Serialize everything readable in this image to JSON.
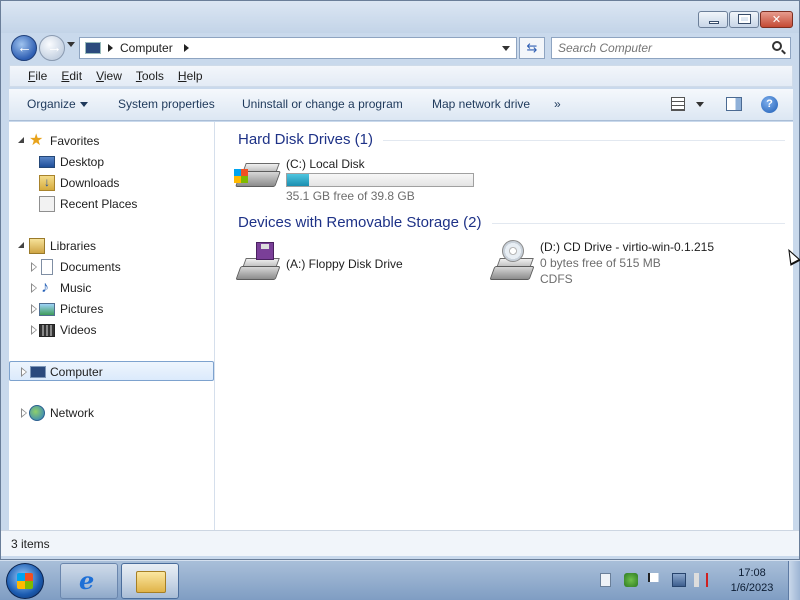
{
  "window": {
    "address": {
      "crumb": "Computer"
    },
    "search": {
      "placeholder": "Search Computer"
    }
  },
  "menubar": {
    "items": [
      {
        "label": "File",
        "accel": "F",
        "rest": "ile"
      },
      {
        "label": "Edit",
        "accel": "E",
        "rest": "dit"
      },
      {
        "label": "View",
        "accel": "V",
        "rest": "iew"
      },
      {
        "label": "Tools",
        "accel": "T",
        "rest": "ools"
      },
      {
        "label": "Help",
        "accel": "H",
        "rest": "elp"
      }
    ]
  },
  "cmdbar": {
    "organize": "Organize",
    "system_properties": "System properties",
    "uninstall": "Uninstall or change a program",
    "map_drive": "Map network drive",
    "more": "»"
  },
  "navpane": {
    "favorites": "Favorites",
    "desktop": "Desktop",
    "downloads": "Downloads",
    "recent": "Recent Places",
    "libraries": "Libraries",
    "documents": "Documents",
    "music": "Music",
    "pictures": "Pictures",
    "videos": "Videos",
    "computer": "Computer",
    "network": "Network"
  },
  "main": {
    "groups": [
      {
        "header": "Hard Disk Drives (1)"
      },
      {
        "header": "Devices with Removable Storage (2)"
      }
    ],
    "drives": {
      "c": {
        "name": "(C:) Local Disk",
        "free": "35.1 GB free of 39.8 GB",
        "used_fraction": 0.118
      },
      "a": {
        "name": "(A:) Floppy Disk Drive"
      },
      "d": {
        "name": "(D:) CD Drive - virtio-win-0.1.215",
        "free": "0 bytes free of 515 MB",
        "fs": "CDFS"
      }
    }
  },
  "status": {
    "items": "3 items"
  },
  "taskbar": {
    "time": "17:08",
    "date": "1/6/2023"
  },
  "colors": {
    "group_header": "#1e3287",
    "progress_fill": "#1b8fb0"
  }
}
